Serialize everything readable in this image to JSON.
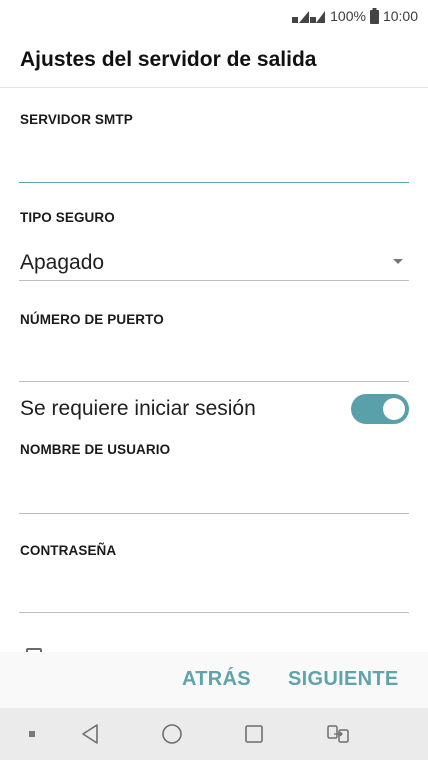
{
  "status_bar": {
    "battery_percent": "100%",
    "time": "10:00"
  },
  "screen": {
    "title": "Ajustes del servidor de salida"
  },
  "form": {
    "smtp_server": {
      "label": "SERVIDOR SMTP",
      "value": ""
    },
    "security_type": {
      "label": "TIPO SEGURO",
      "selected": "Apagado"
    },
    "port_number": {
      "label": "NÚMERO DE PUERTO",
      "value": ""
    },
    "login_required": {
      "label": "Se requiere iniciar sesión",
      "enabled": true
    },
    "username": {
      "label": "NOMBRE DE USUARIO",
      "value": ""
    },
    "password": {
      "label": "CONTRASEÑA",
      "value": ""
    }
  },
  "actions": {
    "back_label": "ATRÁS",
    "next_label": "SIGUIENTE"
  },
  "nav_bar": {
    "items": [
      "notification-dot-icon",
      "back-icon",
      "home-icon",
      "recents-icon",
      "dual-window-icon"
    ]
  },
  "colors": {
    "accent": "#5fa3ad",
    "toggle_on": "#5aa0aa",
    "divider": "#bdbdbd",
    "nav_background": "#ebebeb",
    "action_background": "#f9f9f9"
  }
}
